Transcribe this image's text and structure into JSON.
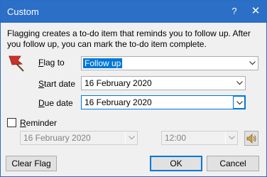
{
  "window": {
    "title": "Custom",
    "help_glyph": "?",
    "close_glyph": "✕"
  },
  "description": {
    "line1": "Flagging creates a to-do item that reminds you to follow up. After",
    "line2": "you follow up, you can mark the to-do item complete."
  },
  "flag_to": {
    "label_prefix": "",
    "label_underline": "F",
    "label_rest": "lag to",
    "value": "Follow up"
  },
  "start_date": {
    "label_prefix": "",
    "label_underline": "S",
    "label_rest": "tart date",
    "value": "16 February 2020"
  },
  "due_date": {
    "label_prefix": "",
    "label_underline": "D",
    "label_rest": "ue date",
    "value": "16 February 2020"
  },
  "reminder": {
    "label_underline": "R",
    "label_rest": "eminder",
    "checked": false,
    "date_value": "16 February 2020",
    "time_value": "12:00"
  },
  "buttons": {
    "clear_flag": "Clear Flag",
    "ok": "OK",
    "cancel": "Cancel"
  },
  "colors": {
    "titlebar": "#2b6fc7",
    "accent": "#0078d7",
    "flag_red": "#c8322a"
  },
  "icons": {
    "flag": "flag-icon",
    "sound": "speaker-icon"
  }
}
